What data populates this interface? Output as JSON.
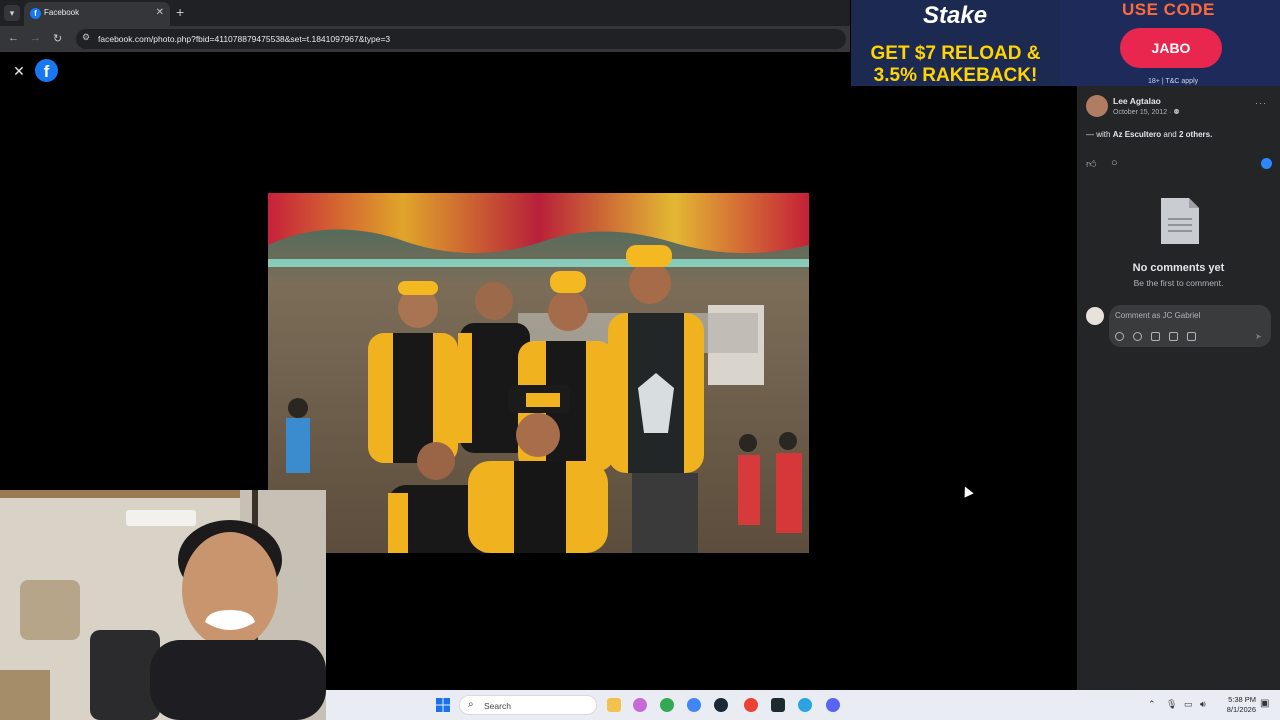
{
  "browser": {
    "tab_title": "Facebook",
    "tab_close": "✕",
    "new_tab": "+",
    "url": "facebook.com/photo.php?fbid=411078879475538&set=t.1841097967&type=3"
  },
  "viewer": {
    "close_glyph": "✕",
    "logo_glyph": "f"
  },
  "ad": {
    "brand": "Stake",
    "headline": "GET $7 RELOAD & 3.5% RAKEBACK!",
    "code_label": "USE CODE",
    "code": "JABO",
    "fine_print": "18+ | T&C apply"
  },
  "post": {
    "author": "Lee Agtalao",
    "date": "October 15, 2012 ·",
    "more": "···",
    "with_prefix": "— with",
    "tagged_person": "Az Escultero",
    "and_text": "and",
    "others": "2 others."
  },
  "comments": {
    "empty_title": "No comments yet",
    "empty_sub": "Be the first to comment.",
    "placeholder": "Comment as JC Gabriel"
  },
  "taskbar": {
    "search_placeholder": "Search",
    "time": "5:38 PM",
    "date": "8/1/2026"
  },
  "colors": {
    "facebook_blue": "#1877f2",
    "sidebar_bg": "#242526",
    "ad_yellow": "#ffd400",
    "ad_pink": "#e8264e"
  }
}
